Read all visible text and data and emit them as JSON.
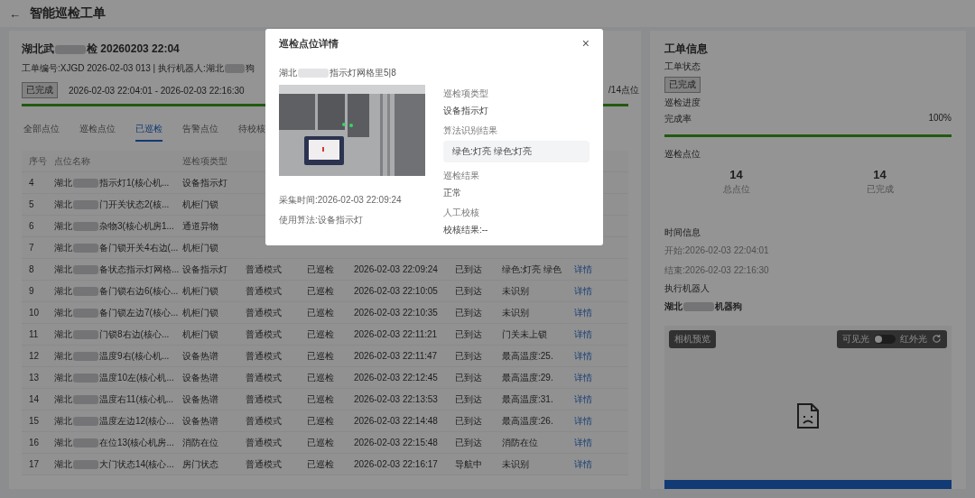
{
  "header": {
    "back_icon": "←",
    "title": "智能巡检工单"
  },
  "order": {
    "title_start": "湖北武",
    "title_end": "检 20260203 22:04",
    "meta_start": "工单编号:XJGD 2026-02-03 013 | 执行机器人:湖北",
    "meta_end": "狗",
    "status_tag": "已完成",
    "time_range": "2026-02-03 22:04:01 - 2026-02-03 22:16:30",
    "progress_text": "/14点位",
    "level": 1
  },
  "tabs": [
    {
      "label": "全部点位",
      "selected": false
    },
    {
      "label": "巡检点位",
      "selected": false
    },
    {
      "label": "已巡检",
      "selected": true
    },
    {
      "label": "告警点位",
      "selected": false
    },
    {
      "label": "待校核",
      "selected": false
    }
  ],
  "table": {
    "columns": [
      "序号",
      "点位名称",
      "巡检项类型"
    ],
    "rows": [
      {
        "no": "4",
        "name_start": "湖北",
        "name_end": "指示灯1(核心机...",
        "type": "设备指示灯"
      },
      {
        "no": "5",
        "name_start": "湖北",
        "name_end": "门开关状态2(核...",
        "type": "机柜门锁"
      },
      {
        "no": "6",
        "name_start": "湖北",
        "name_end": "杂物3(核心机房1...",
        "type": "通道异物"
      },
      {
        "no": "7",
        "name_start": "湖北",
        "name_end": "备门锁开关4右边(...",
        "type": "机柜门锁"
      },
      {
        "no": "8",
        "name_start": "湖北",
        "name_end": "备状态指示灯网格...",
        "type": "设备指示灯",
        "mode": "普通模式",
        "status": "已巡检",
        "time": "2026-02-03 22:09:24",
        "arrival": "已到达",
        "result": "绿色:灯亮 绿色",
        "action": "详情"
      },
      {
        "no": "9",
        "name_start": "湖北",
        "name_end": "备门锁右边6(核心...",
        "type": "机柜门锁",
        "mode": "普通模式",
        "status": "已巡检",
        "time": "2026-02-03 22:10:05",
        "arrival": "已到达",
        "result": "未识别",
        "action": "详情"
      },
      {
        "no": "10",
        "name_start": "湖北",
        "name_end": "备门锁左边7(核心...",
        "type": "机柜门锁",
        "mode": "普通模式",
        "status": "已巡检",
        "time": "2026-02-03 22:10:35",
        "arrival": "已到达",
        "result": "未识别",
        "action": "详情"
      },
      {
        "no": "11",
        "name_start": "湖北",
        "name_end": "门锁8右边(核心...",
        "type": "机柜门锁",
        "mode": "普通模式",
        "status": "已巡检",
        "time": "2026-02-03 22:11:21",
        "arrival": "已到达",
        "result": "门关未上锁",
        "action": "详情"
      },
      {
        "no": "12",
        "name_start": "湖北",
        "name_end": "温度9右(核心机...",
        "type": "设备热谱",
        "mode": "普通模式",
        "status": "已巡检",
        "time": "2026-02-03 22:11:47",
        "arrival": "已到达",
        "result": "最高温度:25.",
        "action": "详情"
      },
      {
        "no": "13",
        "name_start": "湖北",
        "name_end": "温度10左(核心机...",
        "type": "设备热谱",
        "mode": "普通模式",
        "status": "已巡检",
        "time": "2026-02-03 22:12:45",
        "arrival": "已到达",
        "result": "最高温度:29.",
        "action": "详情"
      },
      {
        "no": "14",
        "name_start": "湖北",
        "name_end": "温度右11(核心机...",
        "type": "设备热谱",
        "mode": "普通模式",
        "status": "已巡检",
        "time": "2026-02-03 22:13:53",
        "arrival": "已到达",
        "result": "最高温度:31.",
        "action": "详情"
      },
      {
        "no": "15",
        "name_start": "湖北",
        "name_end": "温度左边12(核心...",
        "type": "设备热谱",
        "mode": "普通模式",
        "status": "已巡检",
        "time": "2026-02-03 22:14:48",
        "arrival": "已到达",
        "result": "最高温度:26.",
        "action": "详情"
      },
      {
        "no": "16",
        "name_start": "湖北",
        "name_end": "在位13(核心机房...",
        "type": "消防在位",
        "mode": "普通模式",
        "status": "已巡检",
        "time": "2026-02-03 22:15:48",
        "arrival": "已到达",
        "result": "消防在位",
        "action": "详情"
      },
      {
        "no": "17",
        "name_start": "湖北",
        "name_end": "大门状态14(核心...",
        "type": "房门状态",
        "mode": "普通模式",
        "status": "已巡检",
        "time": "2026-02-03 22:16:17",
        "arrival": "导航中",
        "result": "未识别",
        "action": "详情"
      }
    ]
  },
  "info": {
    "title": "工单信息",
    "status_label": "工单状态",
    "status_tag": "已完成",
    "progress_label": "巡检进度",
    "rate_label": "完成率",
    "rate_value": "100%",
    "level": 1,
    "points_label": "巡检点位",
    "stats": [
      {
        "value": "14",
        "label": "总点位"
      },
      {
        "value": "14",
        "label": "已完成"
      }
    ],
    "time_label": "时间信息",
    "start": "开始:2026-02-03 22:04:01",
    "end": "结束:2026-02-03 22:16:30",
    "robot_label": "执行机器人",
    "robot_start": "湖北",
    "robot_end": "机器狗"
  },
  "camera": {
    "badge": "相机预览",
    "visible_label": "可见光",
    "switch_on": false,
    "infrared_label": "红外光"
  },
  "modal": {
    "title": "巡检点位详情",
    "close": "×",
    "location_start": "湖北",
    "location_end": "指示灯网格里5|8",
    "capture_time": "采集时间:2026-02-03 22:09:24",
    "algorithm": "使用算法:设备指示灯",
    "fields": [
      {
        "label": "巡检项类型",
        "value": "设备指示灯",
        "kind": "text"
      },
      {
        "label": "算法识别结果",
        "value": "绿色:灯亮 绿色:灯亮",
        "kind": "box"
      },
      {
        "label": "巡检结果",
        "value": "正常",
        "kind": "text"
      },
      {
        "label": "人工校核",
        "value": "校核结果:--",
        "kind": "text"
      }
    ]
  }
}
